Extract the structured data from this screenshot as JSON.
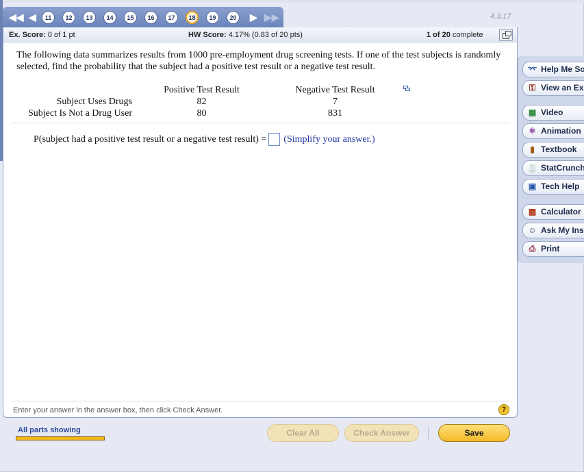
{
  "nav": {
    "question_numbers": [
      "11",
      "12",
      "13",
      "14",
      "15",
      "16",
      "17",
      "18",
      "19",
      "20"
    ],
    "current": "18",
    "first_icon": "double-left-arrow-icon",
    "prev_icon": "left-arrow-icon",
    "next_icon": "right-arrow-icon",
    "last_icon": "double-right-arrow-icon"
  },
  "version": "4.3.17",
  "score_bar": {
    "ex_label": "Ex. Score:",
    "ex_value": "0 of 1 pt",
    "hw_label": "HW Score:",
    "hw_value": "4.17% (0.83 of 20 pts)",
    "complete_bold": "1 of 20",
    "complete_text": "complete"
  },
  "question": {
    "text": "The following data summarizes results from 1000 pre-employment drug screening tests. If one of the test subjects is randomly selected, find the probability that the subject had a positive test result or a negative test result.",
    "table": {
      "columns": [
        "Positive Test Result",
        "Negative Test Result"
      ],
      "rows": [
        {
          "label": "Subject Uses Drugs",
          "values": [
            "82",
            "7"
          ]
        },
        {
          "label": "Subject Is Not a Drug User",
          "values": [
            "80",
            "831"
          ]
        }
      ]
    },
    "answer_prompt": "P(subject had a positive test result or a negative test result) =",
    "answer_value": "",
    "answer_hint": "(Simplify your answer.)"
  },
  "message": "Enter your answer in the answer box, then click Check Answer.",
  "help_symbol": "?",
  "sidebar": {
    "items": [
      {
        "label": "Help Me Solve This",
        "icon": "key-icon"
      },
      {
        "label": "View an Example",
        "icon": "binoculars-icon"
      },
      {
        "label": "Video",
        "icon": "film-icon"
      },
      {
        "label": "Animation",
        "icon": "animation-icon"
      },
      {
        "label": "Textbook",
        "icon": "book-icon"
      },
      {
        "label": "StatCrunch",
        "icon": "statcrunch-icon"
      },
      {
        "label": "Tech Help",
        "icon": "monitor-icon"
      },
      {
        "label": "Calculator",
        "icon": "calculator-icon"
      },
      {
        "label": "Ask My Instructor",
        "icon": "person-icon"
      },
      {
        "label": "Print",
        "icon": "printer-icon"
      }
    ]
  },
  "footer": {
    "parts_label": "All parts showing",
    "clear_label": "Clear All",
    "check_label": "Check Answer",
    "save_label": "Save"
  }
}
